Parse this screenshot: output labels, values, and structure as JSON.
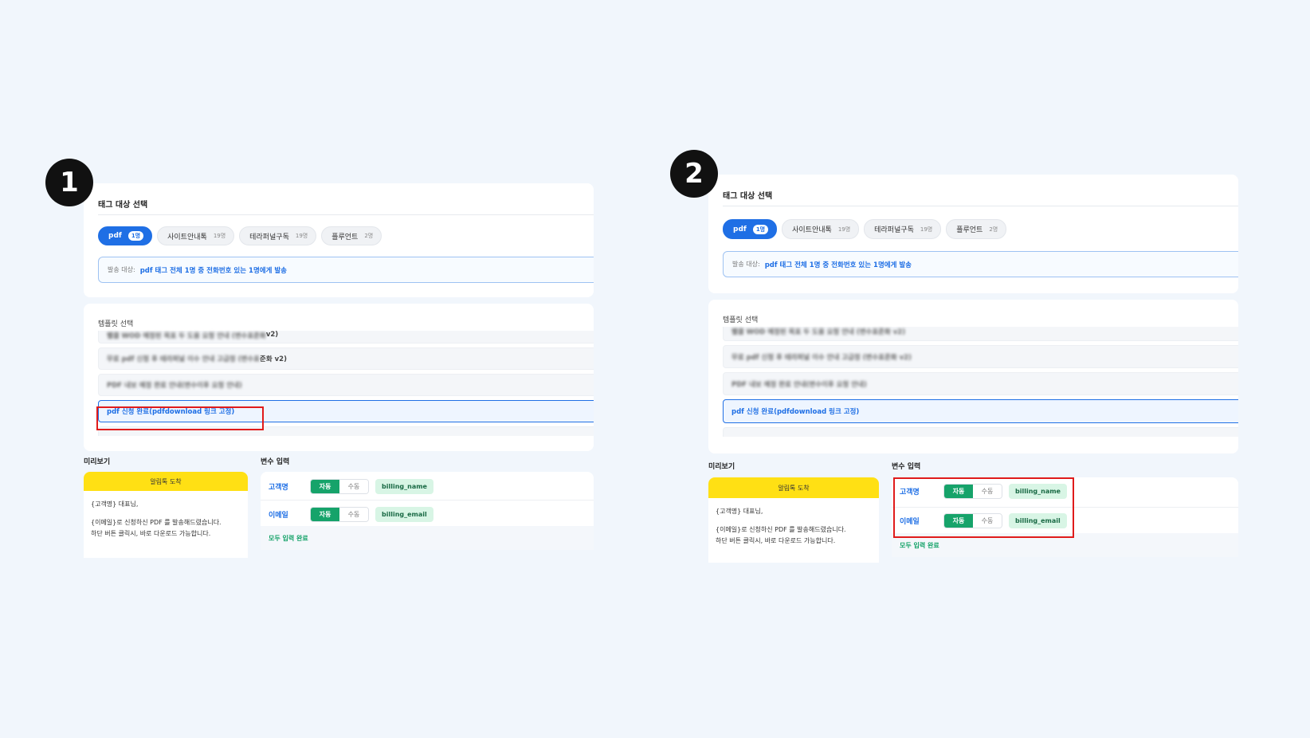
{
  "panels": [
    {
      "step": "1",
      "tag_section": {
        "title": "태그 대상 선택",
        "chips": [
          {
            "label": "pdf",
            "count": "1명"
          },
          {
            "label": "사이트안내톡",
            "count": "19명"
          },
          {
            "label": "테라퍼널구독",
            "count": "19명"
          },
          {
            "label": "플루언트",
            "count": "2명"
          }
        ],
        "target_label": "발송 대상:",
        "target_value": "pdf 태그 전체 1명 중 전화번호 있는 1명에게 발송"
      },
      "template_section": {
        "label": "템플릿 선택",
        "items": [
          {
            "blurred": "웹클 WOD 예정된 목표 두 도움 요청 안내 (변수표준화",
            "tail": " v2)"
          },
          {
            "blurred": "무료 pdf 신청 후 테라퍼널 이수 안내 고급정 (변수표",
            "tail": "준화 v2)"
          },
          {
            "blurred": "PDF 내보 예정 완료 안내(변수이후 요청 안내)",
            "tail": ""
          },
          {
            "selected": "pdf 신청 완료(pdfdownload 링크 고정)"
          }
        ]
      },
      "preview": {
        "label": "미리보기",
        "header": "알림톡 도착",
        "line1": "{고객명} 대표님,",
        "line2": "{이메일}로 신청하신 PDF 를 발송해드렸습니다.",
        "line3": "하단 버튼 클릭시, 바로 다운로드 가능합니다."
      },
      "variables": {
        "label": "변수 입력",
        "rows": [
          {
            "name": "고객명",
            "auto": "자동",
            "manual": "수동",
            "value": "billing_name"
          },
          {
            "name": "이메일",
            "auto": "자동",
            "manual": "수동",
            "value": "billing_email"
          }
        ],
        "footer": "모두 입력 완료"
      }
    },
    {
      "step": "2",
      "tag_section": {
        "title": "태그 대상 선택",
        "chips": [
          {
            "label": "pdf",
            "count": "1명"
          },
          {
            "label": "사이트안내톡",
            "count": "19명"
          },
          {
            "label": "테라퍼널구독",
            "count": "19명"
          },
          {
            "label": "플루언트",
            "count": "2명"
          }
        ],
        "target_label": "발송 대상:",
        "target_value": "pdf 태그 전체 1명 중 전화번호 있는 1명에게 발송"
      },
      "template_section": {
        "label": "템플릿 선택",
        "items": [
          {
            "blurred": "웹클 WOD 예정된 목표 두 도움 요청 안내 (변수표준화 v2)",
            "tail": ""
          },
          {
            "blurred": "무료 pdf 신청 후 테라퍼널 이수 안내 고급정 (변수표준화 v2)",
            "tail": ""
          },
          {
            "blurred": "PDF 내보 예정 완료 안내(변수이후 요청 안내)",
            "tail": ""
          },
          {
            "selected": "pdf 신청 완료(pdfdownload 링크 고정)"
          }
        ]
      },
      "preview": {
        "label": "미리보기",
        "header": "알림톡 도착",
        "line1": "{고객명} 대표님,",
        "line2": "{이메일}로 신청하신 PDF 를 발송해드렸습니다.",
        "line3": "하단 버튼 클릭시, 바로 다운로드 가능합니다."
      },
      "variables": {
        "label": "변수 입력",
        "rows": [
          {
            "name": "고객명",
            "auto": "자동",
            "manual": "수동",
            "value": "billing_name"
          },
          {
            "name": "이메일",
            "auto": "자동",
            "manual": "수동",
            "value": "billing_email"
          }
        ],
        "footer": "모두 입력 완료"
      }
    }
  ],
  "colors": {
    "accent": "#1f6fe5",
    "highlight": "#e01b1b",
    "preview_header": "#ffe014",
    "auto_toggle": "#16a36a"
  }
}
